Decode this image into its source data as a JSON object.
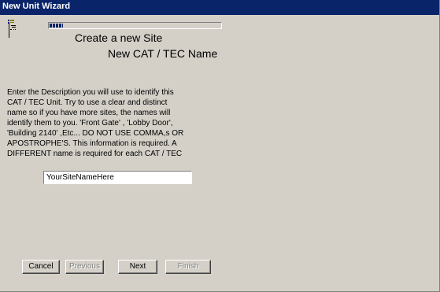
{
  "window": {
    "title": "New Unit Wizard"
  },
  "progress": {
    "value": 0.08,
    "color": "#0a246a"
  },
  "headings": {
    "line1": "Create a new Site",
    "line2": "New CAT / TEC Name"
  },
  "description": "Enter the Description you will use to identify this\nCAT / TEC Unit. Try to use a clear and distinct\nname so if you have more sites, the names will\nidentify them to you. 'Front Gate' , 'Lobby Door',\n'Building 2140' ,Etc... DO NOT USE COMMA,s OR\nAPOSTROPHE'S. This information is required.  A\nDIFFERENT name is required for each CAT / TEC",
  "site_name": {
    "value": "YourSiteNameHere"
  },
  "buttons": {
    "cancel": "Cancel",
    "previous": "Previous",
    "next": "Next",
    "finish": "Finish"
  },
  "icons": {
    "wizard": "wizard-tree-icon"
  }
}
